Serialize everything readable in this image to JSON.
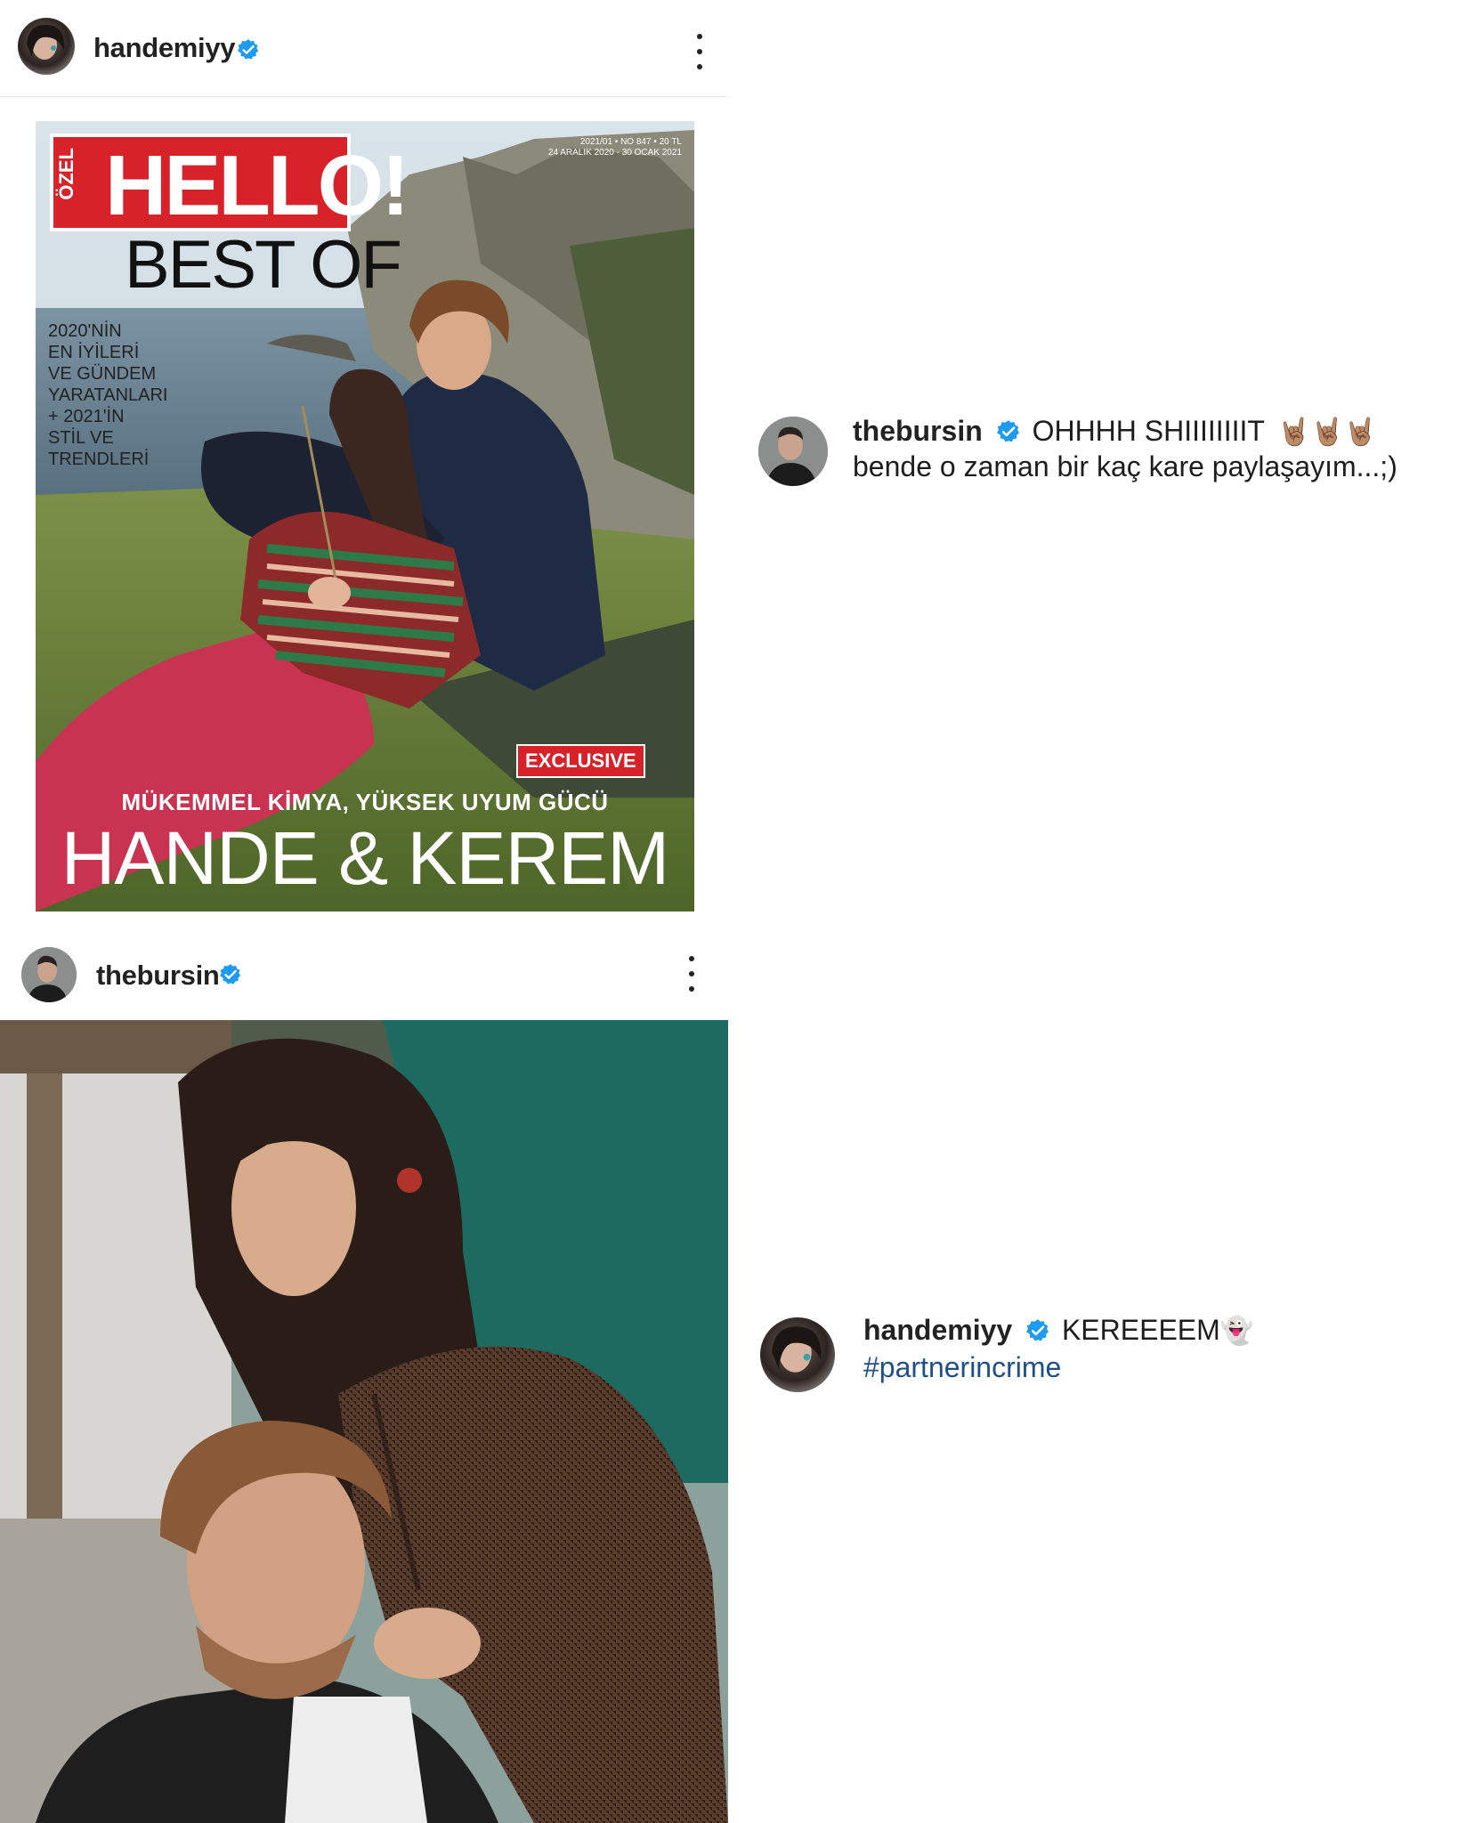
{
  "post1": {
    "username": "handemiyy",
    "cover": {
      "ozel": "ÖZEL",
      "brand": "HELLO!",
      "best_of": "BEST OF",
      "issue_line1": "2021/01 • NO 847 • 20 TL",
      "issue_line2": "24 ARALIK 2020 - 30 OCAK 2021",
      "side_text": "2020'NİN\nEN İYİLERİ\nVE GÜNDEM\nYARATANLARI\n+ 2021'İN\nSTİL VE\nTRENDLERİ",
      "exclusive": "EXCLUSIVE",
      "tagline": "MÜKEMMEL KİMYA, YÜKSEK UYUM GÜCÜ",
      "headline": "HANDE & KEREM"
    }
  },
  "comment1": {
    "username": "thebursin",
    "text_line1": "OHHHH SHIIIIIIIIT",
    "emojis": "🤘🏽🤘🏽🤘🏽",
    "text_line2": "bende o zaman bir kaç kare paylaşayım...;)"
  },
  "post2": {
    "username": "thebursin"
  },
  "comment2": {
    "username": "handemiyy",
    "text": "KEREEEEM",
    "emoji": "👻",
    "hashtag": "#partnerincrime"
  },
  "colors": {
    "verified": "#1d9bf0",
    "hashtag": "#1e4f8a",
    "hello_red": "#d8222a"
  }
}
